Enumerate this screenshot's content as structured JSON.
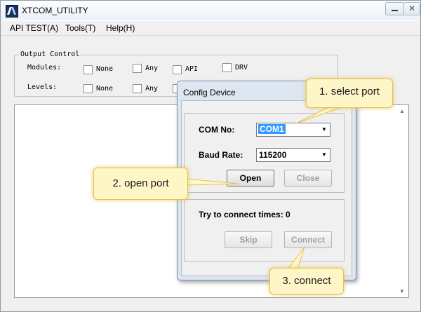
{
  "window": {
    "title": "XTCOM_UTILITY",
    "close_glyph": "✕"
  },
  "menubar": {
    "items": [
      {
        "label": "API TEST(A)"
      },
      {
        "label": "Tools(T)"
      },
      {
        "label": "Help(H)"
      }
    ]
  },
  "output_control": {
    "group_label": "Output Control",
    "modules": {
      "label": "Modules:",
      "options": [
        {
          "label": "None"
        },
        {
          "label": "Any"
        },
        {
          "label": "API"
        },
        {
          "label": "DRV"
        }
      ]
    },
    "levels": {
      "label": "Levels:",
      "options": [
        {
          "label": "None"
        },
        {
          "label": "Any"
        }
      ]
    }
  },
  "config_dialog": {
    "title": "Config Device",
    "com_no": {
      "label": "COM No:",
      "value": "COM1"
    },
    "baud_rate": {
      "label": "Baud Rate:",
      "value": "115200"
    },
    "open_label": "Open",
    "close_label": "Close",
    "connect_status": "Try to connect times: 0",
    "skip_label": "Skip",
    "connect_label": "Connect"
  },
  "callouts": {
    "select_port": "1. select port",
    "open_port": "2. open port",
    "connect": "3. connect"
  },
  "icons": {
    "combo_arrow": "▼",
    "scroll_up": "▲",
    "scroll_down": "▼"
  },
  "colors": {
    "callout_fill": "#fff6c8",
    "callout_border": "#e2c24c",
    "selection": "#3399ff"
  }
}
